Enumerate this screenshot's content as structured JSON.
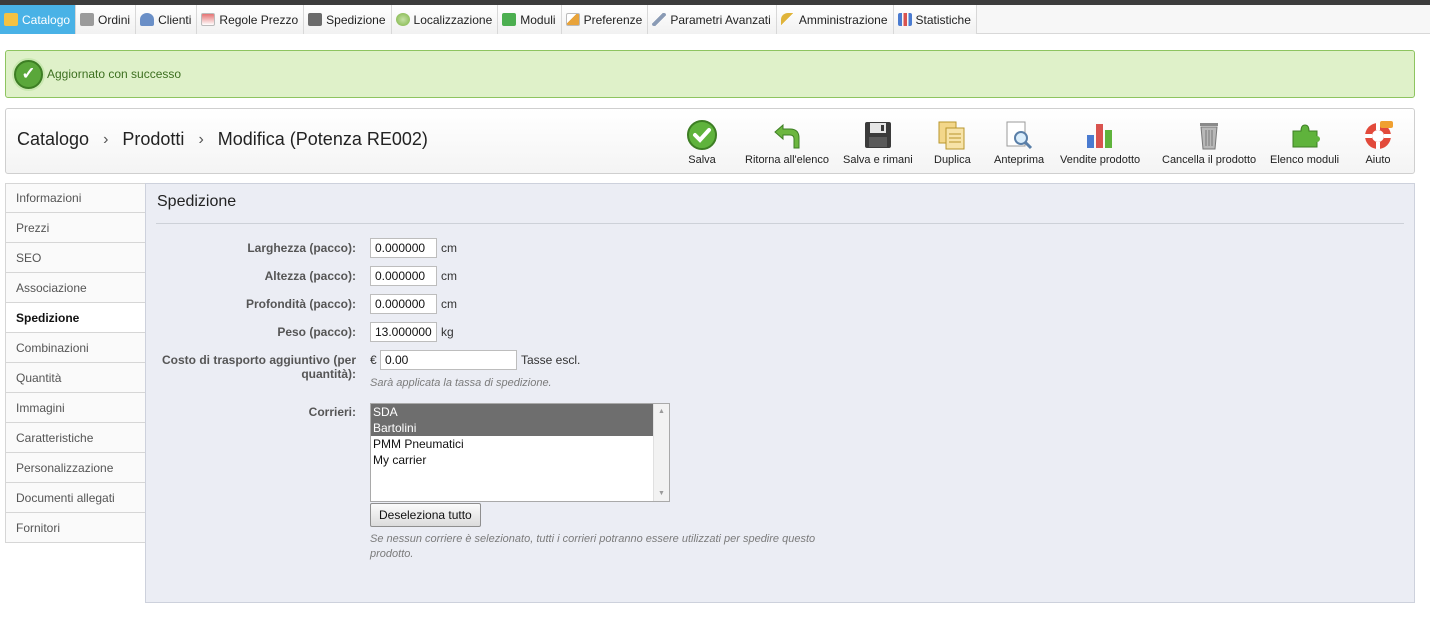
{
  "nav": {
    "tabs": [
      {
        "label": "Catalogo",
        "icon": "folder-icon",
        "color": "#f0b429"
      },
      {
        "label": "Ordini",
        "icon": "cart-icon",
        "color": "#8a8a8a"
      },
      {
        "label": "Clienti",
        "icon": "user-icon",
        "color": "#6a8fc7"
      },
      {
        "label": "Regole Prezzo",
        "icon": "price-rules-icon",
        "color": "#d9534f"
      },
      {
        "label": "Spedizione",
        "icon": "truck-icon",
        "color": "#6b6b6b"
      },
      {
        "label": "Localizzazione",
        "icon": "globe-icon",
        "color": "#7cb342"
      },
      {
        "label": "Moduli",
        "icon": "puzzle-icon",
        "color": "#4caf50"
      },
      {
        "label": "Preferenze",
        "icon": "preferences-icon",
        "color": "#e8a33a"
      },
      {
        "label": "Parametri Avanzati",
        "icon": "wrench-icon",
        "color": "#8a9bb5"
      },
      {
        "label": "Amministrazione",
        "icon": "key-icon",
        "color": "#e0b43a"
      },
      {
        "label": "Statistiche",
        "icon": "bar-chart-icon",
        "color": "#4a7bd0"
      }
    ]
  },
  "alert": {
    "message": "Aggiornato con successo"
  },
  "breadcrumb": {
    "part1": "Catalogo",
    "part2": "Prodotti",
    "part3": "Modifica (Potenza RE002)",
    "separator": "›"
  },
  "toolbar": {
    "save": "Salva",
    "back": "Ritorna all'elenco",
    "save_stay": "Salva e rimani",
    "duplicate": "Duplica",
    "preview": "Anteprima",
    "sales": "Vendite prodotto",
    "delete": "Cancella il prodotto",
    "modules": "Elenco moduli",
    "help": "Aiuto"
  },
  "menu": {
    "items": [
      "Informazioni",
      "Prezzi",
      "SEO",
      "Associazione",
      "Spedizione",
      "Combinazioni",
      "Quantità",
      "Immagini",
      "Caratteristiche",
      "Personalizzazione",
      "Documenti allegati",
      "Fornitori"
    ],
    "active": "Spedizione"
  },
  "shipping": {
    "title": "Spedizione",
    "width_label": "Larghezza (pacco):",
    "width_value": "0.000000",
    "height_label": "Altezza (pacco):",
    "height_value": "0.000000",
    "depth_label": "Profondità (pacco):",
    "depth_value": "0.000000",
    "cm": "cm",
    "weight_label": "Peso (pacco):",
    "weight_value": "13.000000",
    "kg": "kg",
    "extra_cost_label_1": "Costo di trasporto aggiuntivo (per",
    "extra_cost_label_2": "quantità):",
    "currency": "€",
    "extra_cost_value": "0.00",
    "tax_note": "Tasse escl.",
    "tax_hint": "Sarà applicata la tassa di spedizione.",
    "carriers_label": "Corrieri:",
    "carriers": [
      {
        "name": "SDA",
        "selected": true
      },
      {
        "name": "Bartolini",
        "selected": true
      },
      {
        "name": "PMM Pneumatici",
        "selected": false
      },
      {
        "name": "My carrier",
        "selected": false
      }
    ],
    "deselect_button": "Deseleziona tutto",
    "carriers_hint_1": "Se nessun corriere è selezionato, tutti i corrieri potranno essere utilizzati per spedire questo",
    "carriers_hint_2": "prodotto."
  }
}
